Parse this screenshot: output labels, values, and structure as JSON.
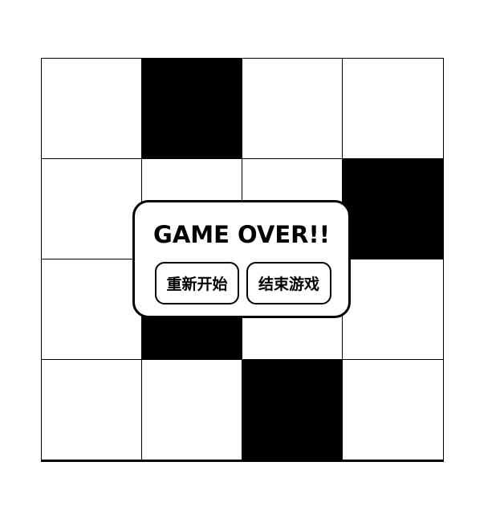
{
  "board": {
    "rows": 4,
    "cols": 4,
    "cells": [
      [
        "white",
        "black",
        "white",
        "white"
      ],
      [
        "white",
        "white",
        "white",
        "black"
      ],
      [
        "white",
        "black",
        "white",
        "white"
      ],
      [
        "white",
        "white",
        "black",
        "white"
      ]
    ],
    "colors": {
      "black": "#000000",
      "white": "#ffffff"
    }
  },
  "dialog": {
    "title": "GAME OVER!!",
    "restart_label": "重新开始",
    "quit_label": "结束游戏"
  }
}
